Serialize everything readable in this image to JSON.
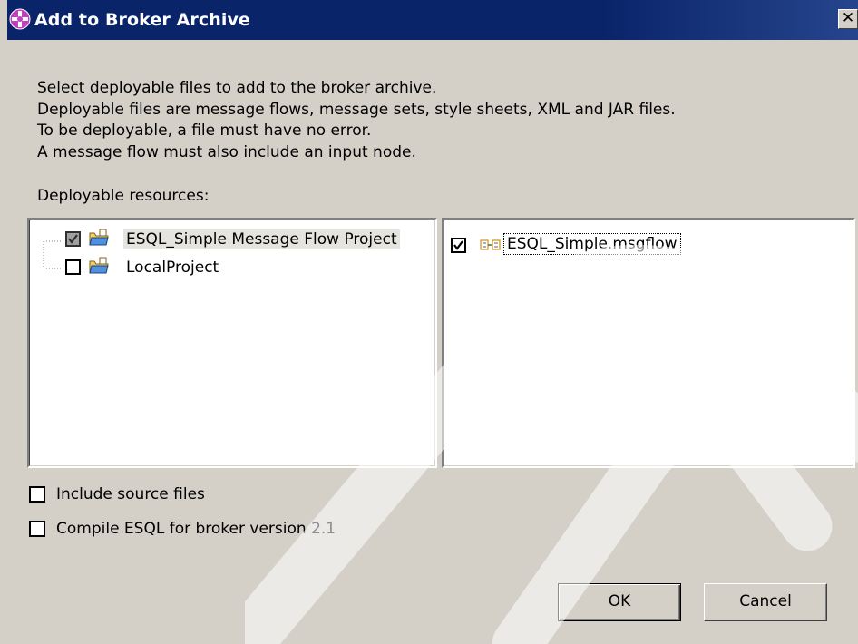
{
  "window": {
    "title": "Add to Broker Archive",
    "icon": "broker-archive-icon",
    "close_icon": "close-icon"
  },
  "description": {
    "lines": [
      "Select deployable files to add to the broker archive.",
      "Deployable files are message flows, message sets, style sheets, XML and JAR files.",
      "To be deployable, a file must have no error.",
      "A message flow must also include an input node."
    ]
  },
  "resources": {
    "label": "Deployable resources:",
    "projects": [
      {
        "label": "ESQL_Simple Message Flow Project",
        "checked": "partial",
        "selected": true,
        "icon": "folder-icon"
      },
      {
        "label": "LocalProject",
        "checked": false,
        "selected": false,
        "icon": "folder-icon"
      }
    ],
    "files": [
      {
        "label": "ESQL_Simple.msgflow",
        "checked": true,
        "focused": true,
        "icon": "msgflow-icon"
      }
    ]
  },
  "options": {
    "include_source": {
      "label": "Include source files",
      "checked": false
    },
    "compile_esql": {
      "label": "Compile ESQL for broker version 2.1",
      "checked": false
    }
  },
  "buttons": {
    "ok": "OK",
    "cancel": "Cancel"
  },
  "colors": {
    "titlebar": "#0a246a",
    "dialog_bg": "#d4d0c8",
    "selection": "#e6e4df"
  }
}
